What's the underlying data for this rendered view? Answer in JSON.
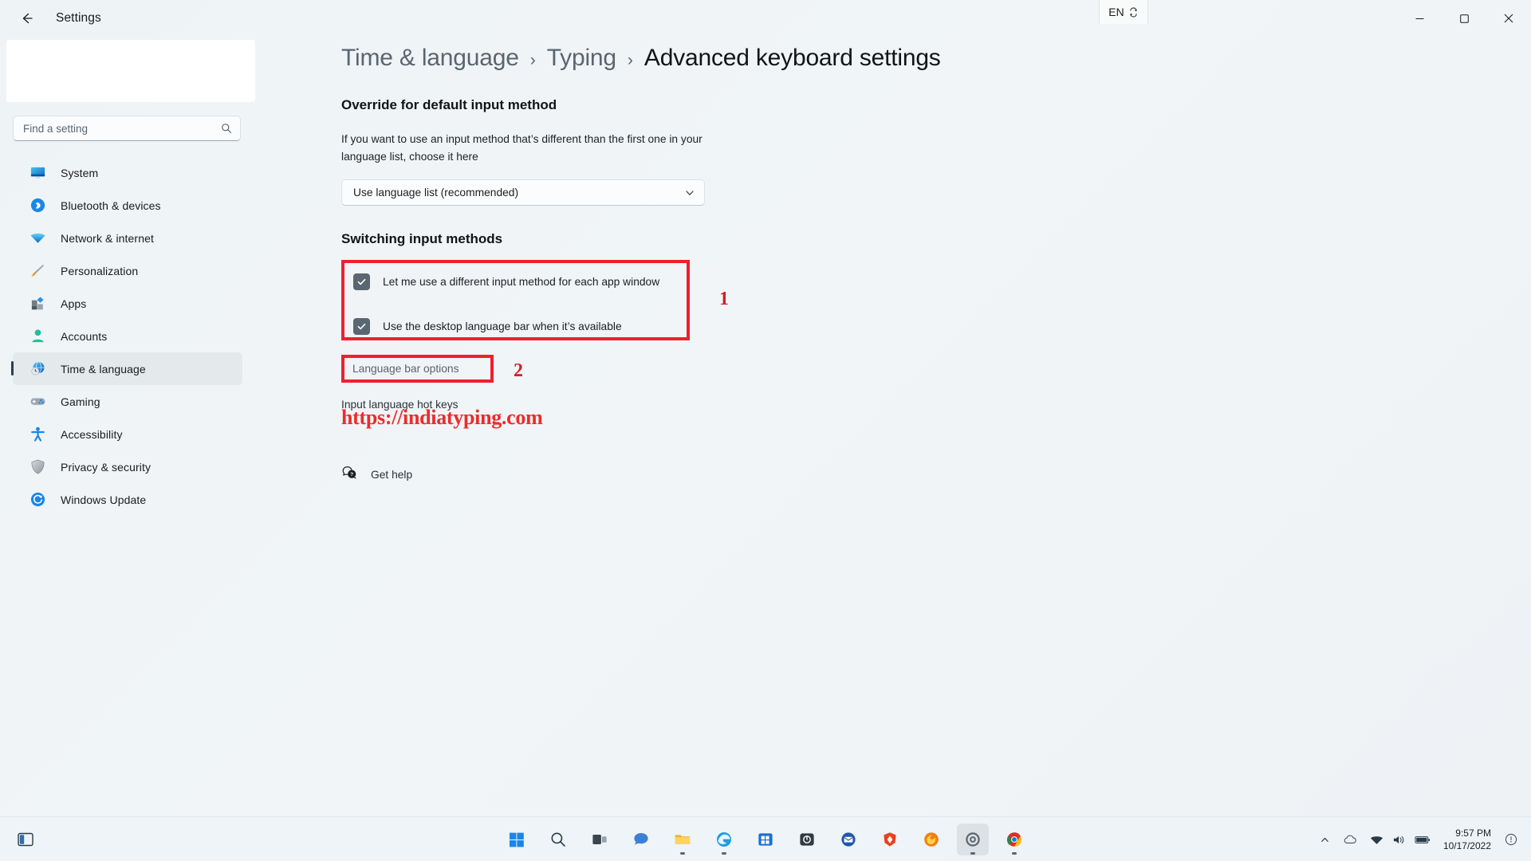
{
  "window": {
    "title": "Settings",
    "back_icon": "back-arrow-icon",
    "lang_indicator": "EN",
    "minimize_label": "Minimize",
    "maximize_label": "Maximize",
    "close_label": "Close"
  },
  "sidebar": {
    "search": {
      "placeholder": "Find a setting",
      "value": ""
    },
    "items": [
      {
        "label": "System",
        "icon": "system-monitor-icon",
        "selected": false
      },
      {
        "label": "Bluetooth & devices",
        "icon": "bluetooth-icon",
        "selected": false
      },
      {
        "label": "Network & internet",
        "icon": "wifi-icon",
        "selected": false
      },
      {
        "label": "Personalization",
        "icon": "paintbrush-icon",
        "selected": false
      },
      {
        "label": "Apps",
        "icon": "apps-grid-icon",
        "selected": false
      },
      {
        "label": "Accounts",
        "icon": "person-icon",
        "selected": false
      },
      {
        "label": "Time & language",
        "icon": "globe-clock-icon",
        "selected": true
      },
      {
        "label": "Gaming",
        "icon": "gamepad-icon",
        "selected": false
      },
      {
        "label": "Accessibility",
        "icon": "accessibility-person-icon",
        "selected": false
      },
      {
        "label": "Privacy & security",
        "icon": "shield-icon",
        "selected": false
      },
      {
        "label": "Windows Update",
        "icon": "update-refresh-icon",
        "selected": false
      }
    ]
  },
  "breadcrumb": {
    "level1": "Time & language",
    "separator": "›",
    "level2": "Typing",
    "current": "Advanced keyboard settings"
  },
  "main": {
    "override_heading": "Override for default input method",
    "override_description": "If you want to use an input method that’s different than the first one in your language list, choose it here",
    "input_method_select": {
      "value": "Use language list (recommended)",
      "chevron": "chevron-down-icon"
    },
    "watermark": "https://indiatyping.com",
    "switching_heading": "Switching input methods",
    "checkboxes": [
      {
        "label": "Let me use a different input method for each app window",
        "checked": true
      },
      {
        "label": "Use the desktop language bar when it’s available",
        "checked": true
      }
    ],
    "language_bar_options": "Language bar options",
    "input_hot_keys": "Input language hot keys",
    "get_help": "Get help",
    "get_help_icon": "help-chat-bubble-icon",
    "annotations": [
      {
        "number": "1"
      },
      {
        "number": "2"
      }
    ]
  },
  "taskbar": {
    "widgets_icon": "widgets-icon",
    "items": [
      {
        "name": "start-button",
        "icon": "windows-logo-icon",
        "running": false
      },
      {
        "name": "search-button",
        "icon": "search-icon",
        "running": false
      },
      {
        "name": "task-view-button",
        "icon": "task-view-icon",
        "running": false
      },
      {
        "name": "chat-button",
        "icon": "chat-icon",
        "running": false
      },
      {
        "name": "file-explorer-button",
        "icon": "folder-icon",
        "running": true
      },
      {
        "name": "edge-button",
        "icon": "edge-browser-icon",
        "running": true
      },
      {
        "name": "store-button",
        "icon": "microsoft-store-icon",
        "running": false
      },
      {
        "name": "app-button",
        "icon": "app-window-icon",
        "running": false
      },
      {
        "name": "mail-button",
        "icon": "mail-icon",
        "running": false
      },
      {
        "name": "brave-button",
        "icon": "brave-browser-icon",
        "running": false
      },
      {
        "name": "firefox-button",
        "icon": "firefox-browser-icon",
        "running": false
      },
      {
        "name": "settings-button",
        "icon": "gear-icon",
        "running": true
      },
      {
        "name": "chrome-button",
        "icon": "chrome-browser-icon",
        "running": true
      }
    ],
    "tray": {
      "chevron": "chevron-up-icon",
      "cloud_icon": "cloud-icon",
      "network_icon": "wifi-tray-icon",
      "volume_icon": "speaker-icon",
      "battery_icon": "battery-icon",
      "notification_icon": "notification-bell-icon"
    },
    "clock": {
      "time": "9:57 PM",
      "date": "10/17/2022"
    }
  }
}
